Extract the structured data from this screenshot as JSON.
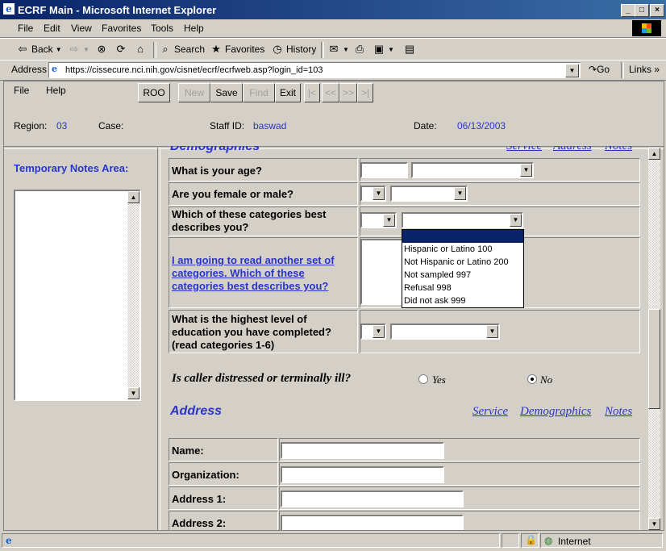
{
  "window": {
    "title": "ECRF Main - Microsoft Internet Explorer"
  },
  "menu": [
    "File",
    "Edit",
    "View",
    "Favorites",
    "Tools",
    "Help"
  ],
  "toolbar": {
    "back": "Back",
    "search": "Search",
    "favorites": "Favorites",
    "history": "History"
  },
  "address": {
    "label": "Address",
    "url": "https://cissecure.nci.nih.gov/cisnet/ecrf/ecrfweb.asp?login_id=103",
    "go": "Go",
    "links": "Links"
  },
  "app": {
    "menu": [
      "File",
      "Help"
    ],
    "buttons": [
      {
        "label": "ROO",
        "enabled": true
      },
      {
        "label": "New",
        "enabled": false
      },
      {
        "label": "Save",
        "enabled": true
      },
      {
        "label": "Find",
        "enabled": false
      },
      {
        "label": "Exit",
        "enabled": true
      }
    ],
    "nav_buttons": [
      "|<",
      "<<",
      ">>",
      ">|"
    ],
    "region_label": "Region:",
    "region_value": "03",
    "case_label": "Case:",
    "staff_label": "Staff ID:",
    "staff_value": "baswad",
    "date_label": "Date:",
    "date_value": "06/13/2003"
  },
  "notes": {
    "title": "Temporary Notes Area:"
  },
  "demographics": {
    "heading": "Demographics",
    "links": [
      "Service",
      "Address",
      "Notes"
    ],
    "questions": {
      "age": "What is your age?",
      "gender": "Are you female or male?",
      "category": "Which of these categories best describes you?",
      "another_set": "I am going to read another set of categories. Which of these categories best describes you?",
      "education": "What is the highest level of education you have completed? (read categories 1-6)"
    },
    "dropdown_options": [
      "",
      "Hispanic or Latino  100",
      "Not Hispanic or Latino  200",
      "Not sampled  997",
      "Refusal  998",
      "Did not ask  999"
    ],
    "distressed_question": "Is caller distressed or terminally ill?",
    "yes": "Yes",
    "no": "No"
  },
  "address_section": {
    "heading": "Address",
    "links": [
      "Service",
      "Demographics",
      "Notes"
    ],
    "fields": [
      "Name:",
      "Organization:",
      "Address 1:",
      "Address 2:"
    ]
  },
  "status": {
    "zone": "Internet"
  }
}
